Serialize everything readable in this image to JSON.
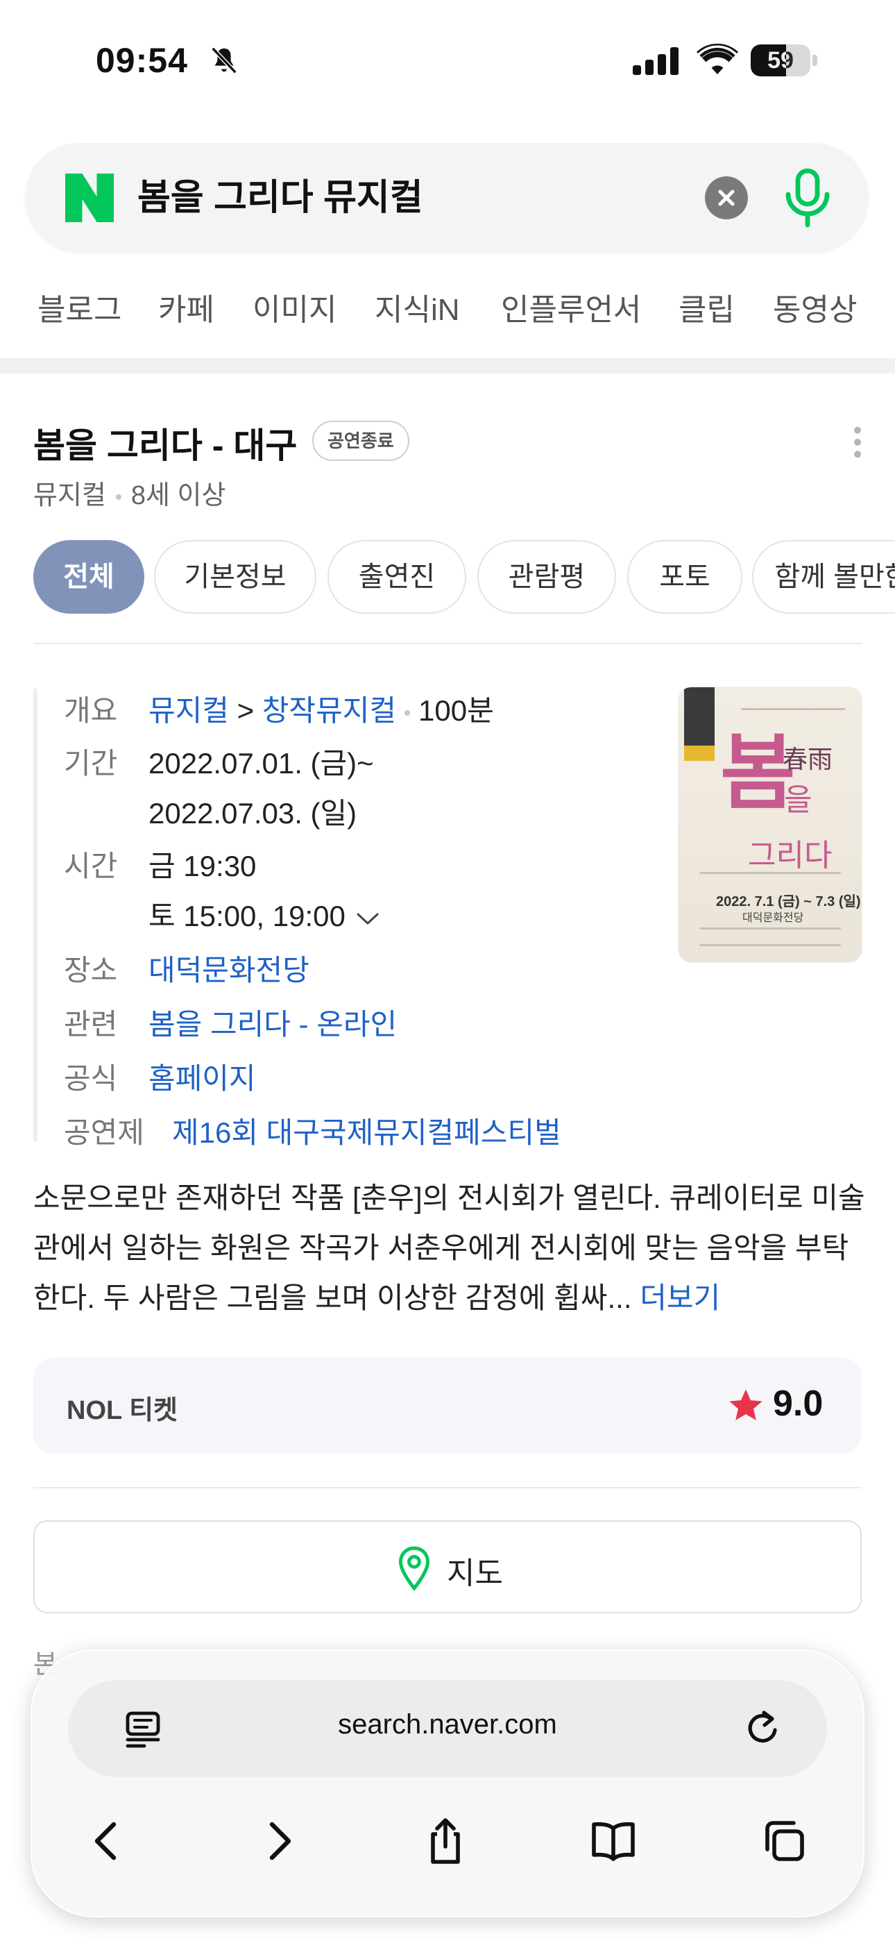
{
  "status_bar": {
    "time": "09:54",
    "battery": "59",
    "battery_level": 0.59
  },
  "search": {
    "query": "봄을 그리다 뮤지컬"
  },
  "category_tabs": [
    "블로그",
    "카페",
    "이미지",
    "지식iN",
    "인플루언서",
    "클립",
    "동영상"
  ],
  "card": {
    "title": "봄을 그리다 - 대구",
    "status_badge": "공연종료",
    "genre": "뮤지컬",
    "age": "8세 이상",
    "chips": [
      "전체",
      "기본정보",
      "출연진",
      "관람평",
      "포토",
      "함께 볼만한"
    ],
    "info": {
      "overview_label": "개요",
      "overview_genre": "뮤지컬",
      "overview_arrow": ">",
      "overview_subgenre": "창작뮤지컬",
      "overview_runtime": "100분",
      "period_label": "기간",
      "period_start": "2022.07.01. (금)~",
      "period_end": "2022.07.03. (일)",
      "time_label": "시간",
      "time_line1": "금 19:30",
      "time_line2": "토 15:00, 19:00",
      "venue_label": "장소",
      "venue": "대덕문화전당",
      "related_label": "관련",
      "related": "봄을 그리다 - 온라인",
      "official_label": "공식",
      "official": "홈페이지",
      "festival_label": "공연제",
      "festival": "제16회 대구국제뮤지컬페스티벌"
    },
    "poster": {
      "big_char": "봄",
      "hanja": "春雨",
      "suffix_char": "을",
      "subtitle": "그리다",
      "date": "2022. 7.1 (금) ~ 7.3 (일)",
      "venue": "대덕문화전당"
    },
    "description": "소문으로만 존재하던 작품 [춘우]의 전시회가 열린다. 큐레이터로 미술관에서 일하는 화원은 작곡가 서춘우에게 전시회에 맞는 음악을 부탁한다. 두 사람은 그림을 보며 이상한 감정에 휩싸...",
    "description_more": "더보기",
    "ticket": {
      "name": "NOL 티켓",
      "rating": "9.0"
    },
    "map_label": "지도",
    "faded_text": "본"
  },
  "browser": {
    "url": "search.naver.com"
  },
  "colors": {
    "naver_green": "#03c75a",
    "link_blue": "#1e61c7",
    "chip_active": "#8193b8",
    "star_red": "#e9344c"
  },
  "icons": [
    "bell-slash-icon",
    "signal-icon",
    "wifi-icon",
    "naver-logo",
    "clear-icon",
    "mic-icon",
    "more-vertical-icon",
    "chevron-down-icon",
    "star-icon",
    "map-pin-icon",
    "reader-icon",
    "reload-icon",
    "back-icon",
    "forward-icon",
    "share-icon",
    "bookmarks-icon",
    "tabs-icon"
  ]
}
